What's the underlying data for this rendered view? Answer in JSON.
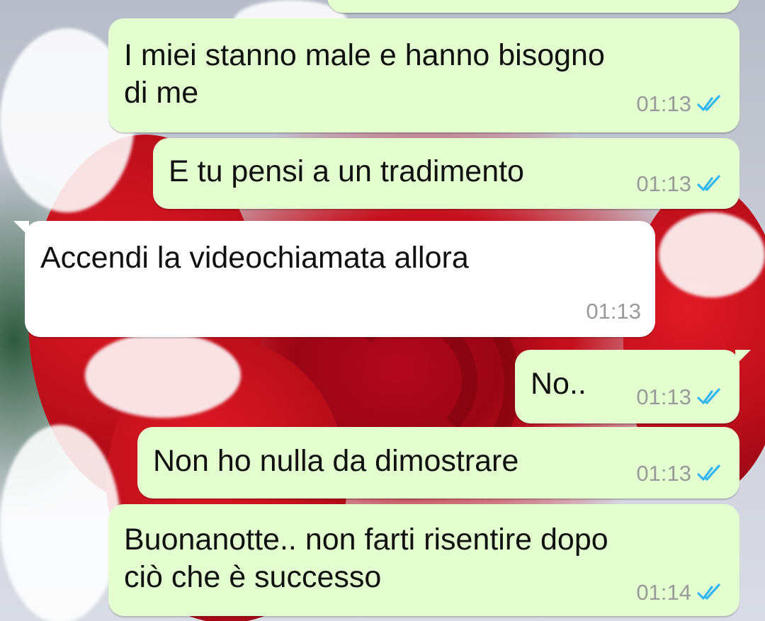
{
  "messages": [
    {
      "text": "",
      "time": "",
      "status": "read"
    },
    {
      "text": "I miei stanno male e hanno bisogno\ndi me",
      "time": "01:13",
      "status": "read"
    },
    {
      "text": "E tu pensi a un tradimento",
      "time": "01:13",
      "status": "read"
    },
    {
      "text": "Accendi la videochiamata allora",
      "time": "01:13",
      "status": ""
    },
    {
      "text": "No..",
      "time": "01:13",
      "status": "read"
    },
    {
      "text": "Non ho nulla da dimostrare",
      "time": "01:13",
      "status": "read"
    },
    {
      "text": "Buonanotte.. non farti risentire dopo\nciò che è successo",
      "time": "01:14",
      "status": "read"
    }
  ],
  "colors": {
    "outgoing_bubble": "#e3ffcf",
    "incoming_bubble": "#ffffff",
    "read_ticks": "#34b7f1",
    "time_text": "#9a9a9a"
  },
  "wallpaper": "red rose covered in snow",
  "icons": {
    "read_receipt": "double-check-icon"
  }
}
